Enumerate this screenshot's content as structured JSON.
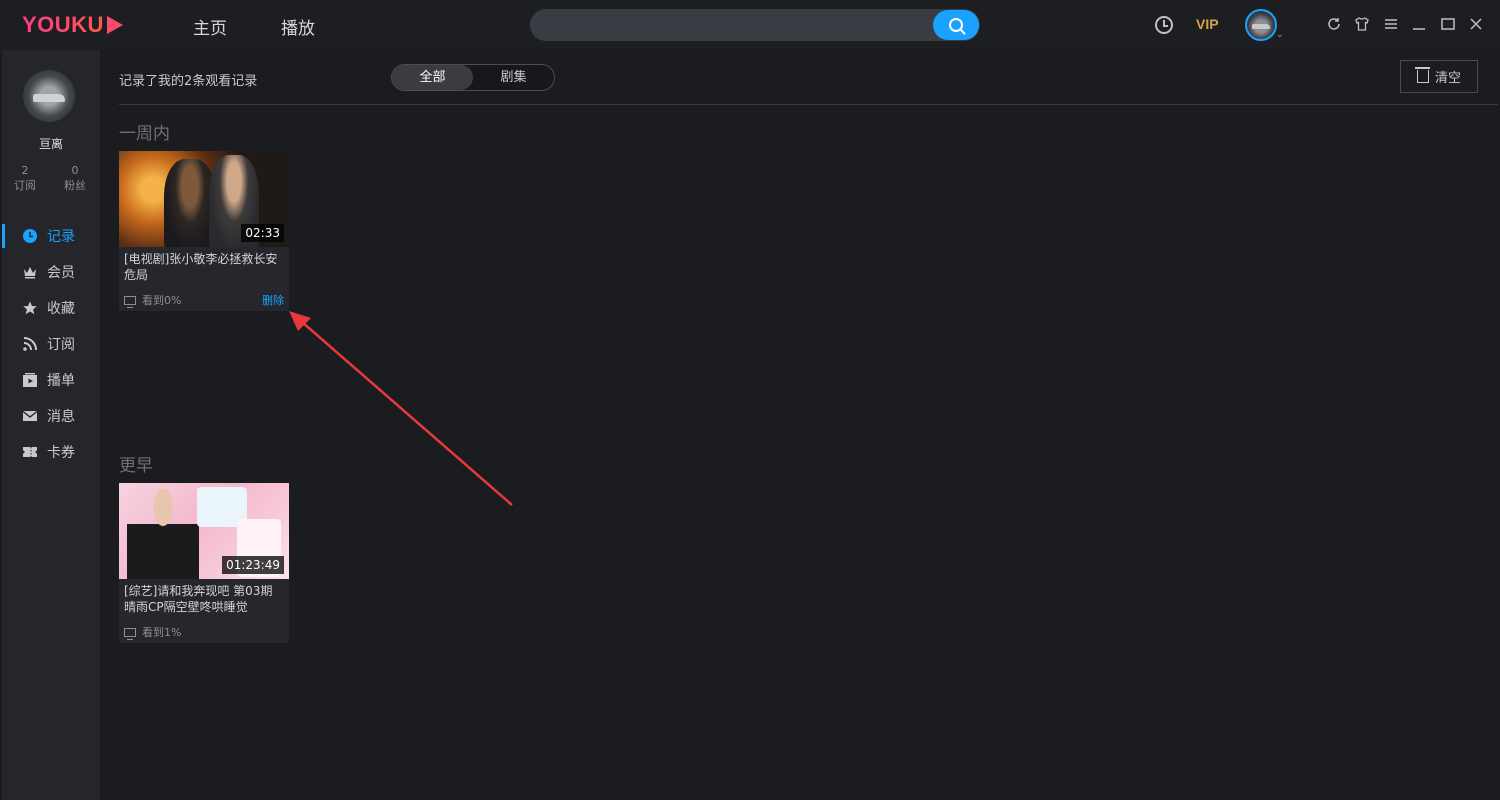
{
  "app": {
    "logo": "YOUKU",
    "nav": {
      "home": "主页",
      "play": "播放"
    },
    "search": {
      "placeholder": ""
    },
    "vip_label": "VIP"
  },
  "colors": {
    "accent": "#1aa2ff",
    "vip": "#d4a24a",
    "logo": "#ff4a78",
    "annotation_arrow": "#e8393a"
  },
  "sidebar": {
    "username": "亘离",
    "stats": [
      {
        "num": "2",
        "label": "订阅"
      },
      {
        "num": "0",
        "label": "粉丝"
      }
    ],
    "items": [
      {
        "label": "记录",
        "icon": "clock-icon",
        "active": true
      },
      {
        "label": "会员",
        "icon": "crown-icon"
      },
      {
        "label": "收藏",
        "icon": "star-icon"
      },
      {
        "label": "订阅",
        "icon": "rss-icon"
      },
      {
        "label": "播单",
        "icon": "playlist-icon"
      },
      {
        "label": "消息",
        "icon": "mail-icon"
      },
      {
        "label": "卡券",
        "icon": "ticket-icon"
      }
    ]
  },
  "main": {
    "summary": "记录了我的2条观看记录",
    "tabs": [
      {
        "label": "全部",
        "active": true
      },
      {
        "label": "剧集"
      }
    ],
    "clear_label": "清空",
    "sections": [
      {
        "title": "一周内",
        "items": [
          {
            "title": "[电视剧]张小敬李必拯救长安危局",
            "duration": "02:33",
            "progress": "看到0%",
            "delete_label": "删除"
          }
        ]
      },
      {
        "title": "更早",
        "items": [
          {
            "title": "[综艺]请和我奔现吧 第03期 晴雨CP隔空壁咚哄睡觉",
            "duration": "01:23:49",
            "progress": "看到1%"
          }
        ]
      }
    ]
  }
}
